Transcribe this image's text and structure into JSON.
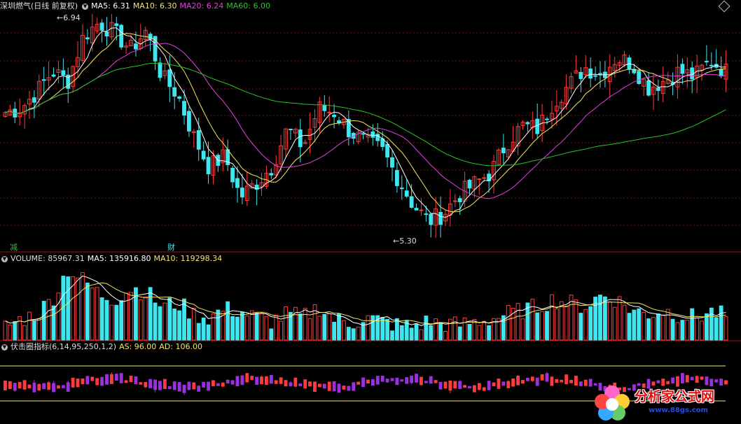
{
  "panels": {
    "price": {
      "title": "深圳燃气(日线 前复权)",
      "legend": [
        {
          "label": "MA5: 6.31",
          "color": "#ffffff"
        },
        {
          "label": "MA10: 6.30",
          "color": "#f5e663"
        },
        {
          "label": "MA20: 6.24",
          "color": "#e040e0"
        },
        {
          "label": "MA60: 6.00",
          "color": "#29c429"
        }
      ],
      "high_label": "6.94",
      "low_label": "5.30",
      "markers": [
        "减",
        "财"
      ]
    },
    "volume": {
      "legend": [
        {
          "label": "VOLUME: 85967.31",
          "color": "#dddddd"
        },
        {
          "label": "MA5: 135916.80",
          "color": "#ffffff"
        },
        {
          "label": "MA10: 119298.34",
          "color": "#f5e663"
        }
      ]
    },
    "indicator": {
      "legend": [
        {
          "label": "伏击圈指标(6,14,95,250,1,2)",
          "color": "#dddddd"
        },
        {
          "label": "AS: 96.00",
          "color": "#f5e663"
        },
        {
          "label": "AD: 106.00",
          "color": "#f5e663"
        }
      ]
    }
  },
  "watermark": {
    "title": "分析家公式网",
    "url": "www.88gs.com"
  },
  "colors": {
    "up": "#ff3b3b",
    "down": "#3ee6f0",
    "ma5": "#ffffff",
    "ma10": "#f5e663",
    "ma20": "#e040e0",
    "ma60": "#29c429",
    "grid": "#7a1010",
    "purple": "#9b30e0"
  },
  "chart_data": [
    {
      "type": "candlestick",
      "title": "深圳燃气(日线 前复权)",
      "ylim": [
        5.3,
        6.94
      ],
      "annotations": [
        {
          "label": "6.94",
          "value": 6.94
        },
        {
          "label": "5.30",
          "value": 5.3
        }
      ],
      "series": [
        {
          "name": "MA5",
          "last": 6.31
        },
        {
          "name": "MA10",
          "last": 6.3
        },
        {
          "name": "MA20",
          "last": 6.24
        },
        {
          "name": "MA60",
          "last": 6.0
        }
      ],
      "keypoints": [
        6.22,
        6.25,
        6.37,
        6.52,
        6.45,
        6.78,
        6.88,
        6.8,
        6.68,
        6.82,
        6.48,
        6.35,
        6.05,
        5.82,
        5.9,
        5.6,
        5.7,
        5.82,
        6.1,
        5.97,
        6.25,
        6.22,
        6.08,
        6.0,
        5.95,
        5.75,
        5.55,
        5.42,
        5.48,
        5.62,
        5.7,
        5.78,
        6.0,
        6.12,
        6.1,
        6.3,
        6.42,
        6.55,
        6.5,
        6.62,
        6.58,
        6.4,
        6.45,
        6.52,
        6.48,
        6.6,
        6.52
      ],
      "grid": true
    },
    {
      "type": "bar",
      "title": "VOLUME",
      "series": [
        {
          "name": "VOLUME",
          "last": 85967.31
        },
        {
          "name": "MA5",
          "last": 135916.8
        },
        {
          "name": "MA10",
          "last": 119298.34
        }
      ],
      "keypoints": [
        0.18,
        0.28,
        0.35,
        0.55,
        0.95,
        0.8,
        0.62,
        0.55,
        0.7,
        0.65,
        0.45,
        0.5,
        0.35,
        0.3,
        0.42,
        0.38,
        0.3,
        0.25,
        0.35,
        0.3,
        0.45,
        0.28,
        0.22,
        0.3,
        0.25,
        0.2,
        0.18,
        0.25,
        0.22,
        0.2,
        0.25,
        0.28,
        0.35,
        0.4,
        0.45,
        0.55,
        0.5,
        0.45,
        0.6,
        0.55,
        0.4,
        0.35,
        0.4,
        0.35,
        0.3,
        0.38,
        0.32
      ]
    },
    {
      "type": "bar",
      "title": "伏击圈指标(6,14,95,250,1,2)",
      "series": [
        {
          "name": "AS",
          "last": 96.0
        },
        {
          "name": "AD",
          "last": 106.0
        }
      ]
    }
  ]
}
